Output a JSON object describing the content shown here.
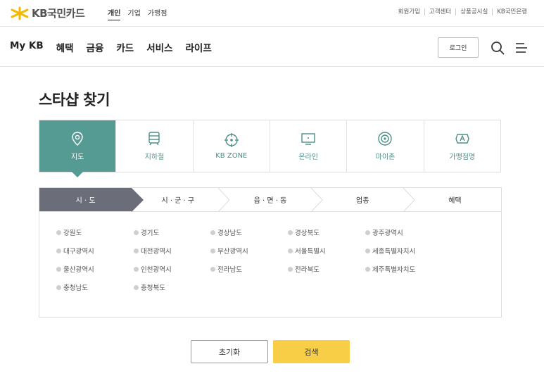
{
  "brand": {
    "name": "KB국민카드",
    "accent": "#f7ce46",
    "teal": "#559b93"
  },
  "top_tabs": [
    "개인",
    "기업",
    "가맹점"
  ],
  "util_links": [
    "회원가입",
    "고객센터",
    "상품공시실",
    "KB국민은행"
  ],
  "nav": {
    "items": [
      "My KB",
      "혜택",
      "금융",
      "카드",
      "서비스",
      "라이프"
    ],
    "login_label": "로그인"
  },
  "page": {
    "title": "스타샵 찾기"
  },
  "type_tabs": [
    {
      "label": "지도",
      "icon": "map-pin-icon",
      "active": true
    },
    {
      "label": "지하철",
      "icon": "subway-icon"
    },
    {
      "label": "KB ZONE",
      "icon": "target-icon"
    },
    {
      "label": "온라인",
      "icon": "monitor-icon"
    },
    {
      "label": "마이존",
      "icon": "myzone-icon"
    },
    {
      "label": "가맹점명",
      "icon": "store-name-icon"
    }
  ],
  "steps": [
    "시 · 도",
    "시 · 군 · 구",
    "읍 · 면 · 동",
    "업종",
    "혜택"
  ],
  "regions": [
    [
      "강원도",
      "경기도",
      "경상남도",
      "경상북도",
      "광주광역시"
    ],
    [
      "대구광역시",
      "대전광역시",
      "부산광역시",
      "서울특별시",
      "세종특별자치시"
    ],
    [
      "울산광역시",
      "인천광역시",
      "전라남도",
      "전라북도",
      "제주특별자치도"
    ],
    [
      "충청남도",
      "충청북도"
    ]
  ],
  "buttons": {
    "reset": "초기화",
    "search": "검색"
  }
}
